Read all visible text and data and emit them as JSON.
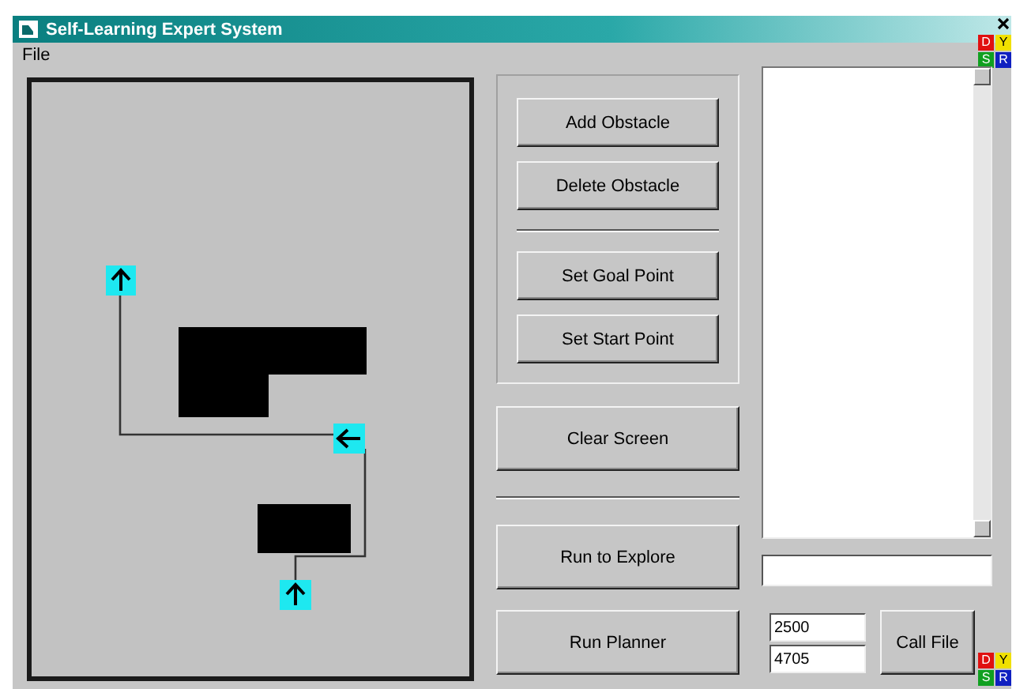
{
  "window": {
    "title": "Self-Learning Expert System"
  },
  "menu": [
    "File"
  ],
  "corner_badges": [
    {
      "label": "D",
      "color": "#e01010"
    },
    {
      "label": "Y",
      "color": "#f0e000"
    },
    {
      "label": "S",
      "color": "#10a020"
    },
    {
      "label": "R",
      "color": "#1020c0"
    }
  ],
  "obstacle_buttons": [
    "Add Obstacle",
    "Delete Obstacle"
  ],
  "point_buttons": [
    "Set Goal Point",
    "Set Start Point"
  ],
  "clear_button": "Clear Screen",
  "run_buttons": [
    "Run to Explore",
    "Run Planner"
  ],
  "fields": [
    {
      "value": "2500"
    },
    {
      "value": "4705"
    }
  ],
  "call_button": "Call File",
  "bottom_badges": [
    {
      "label": "D",
      "color": "#e01010"
    },
    {
      "label": "Y",
      "color": "#f0e000"
    },
    {
      "label": "S",
      "color": "#10a020"
    },
    {
      "label": "R",
      "color": "#1020c0"
    }
  ]
}
